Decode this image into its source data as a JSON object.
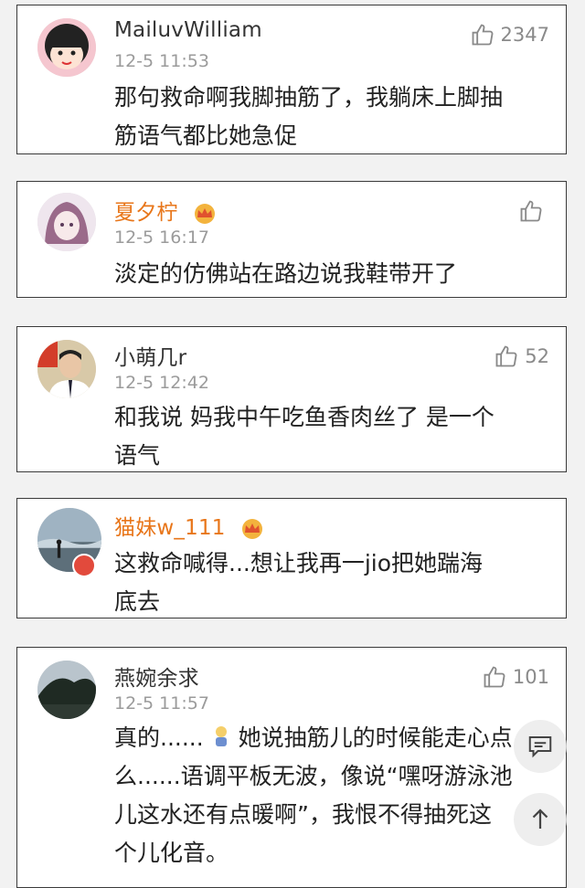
{
  "comments": [
    {
      "username": "MailuvWilliam",
      "time": "12-5 11:53",
      "likes": "2347",
      "text_lines": [
        "那句救命啊我脚抽筋了，我躺床上脚抽",
        "筋语气都比她急促"
      ]
    },
    {
      "username": "夏夕柠",
      "time": "12-5 16:17",
      "likes": "",
      "text_lines": [
        "淡定的仿佛站在路边说我鞋带开了"
      ]
    },
    {
      "username": "小萌几r",
      "time": "12-5 12:42",
      "likes": "52",
      "text_lines": [
        "和我说 妈我中午吃鱼香肉丝了 是一个",
        "语气"
      ]
    },
    {
      "username": "猫妹w_111",
      "time": "",
      "likes": "",
      "text_lines": [
        "这救命喊得...想让我再一jio把她踹海",
        "底去"
      ]
    },
    {
      "username": "燕婉余求",
      "time": "12-5 11:57",
      "likes": "101",
      "text_lines": [
        "真的......",
        "她说抽筋儿的时候能走心点",
        "么......语调平板无波，像说“嘿呀游泳池",
        "儿这水还有点暖啊”，我恨不得抽死这",
        "个儿化音。"
      ]
    }
  ],
  "icons": {
    "like": "thumbs-up-icon",
    "vip": "crown-icon",
    "comment_fab": "comment-icon",
    "scroll_top_fab": "arrow-up-icon"
  },
  "colors": {
    "vip_name": "#e8761a",
    "text": "#222222",
    "meta": "#9b9b9b"
  }
}
